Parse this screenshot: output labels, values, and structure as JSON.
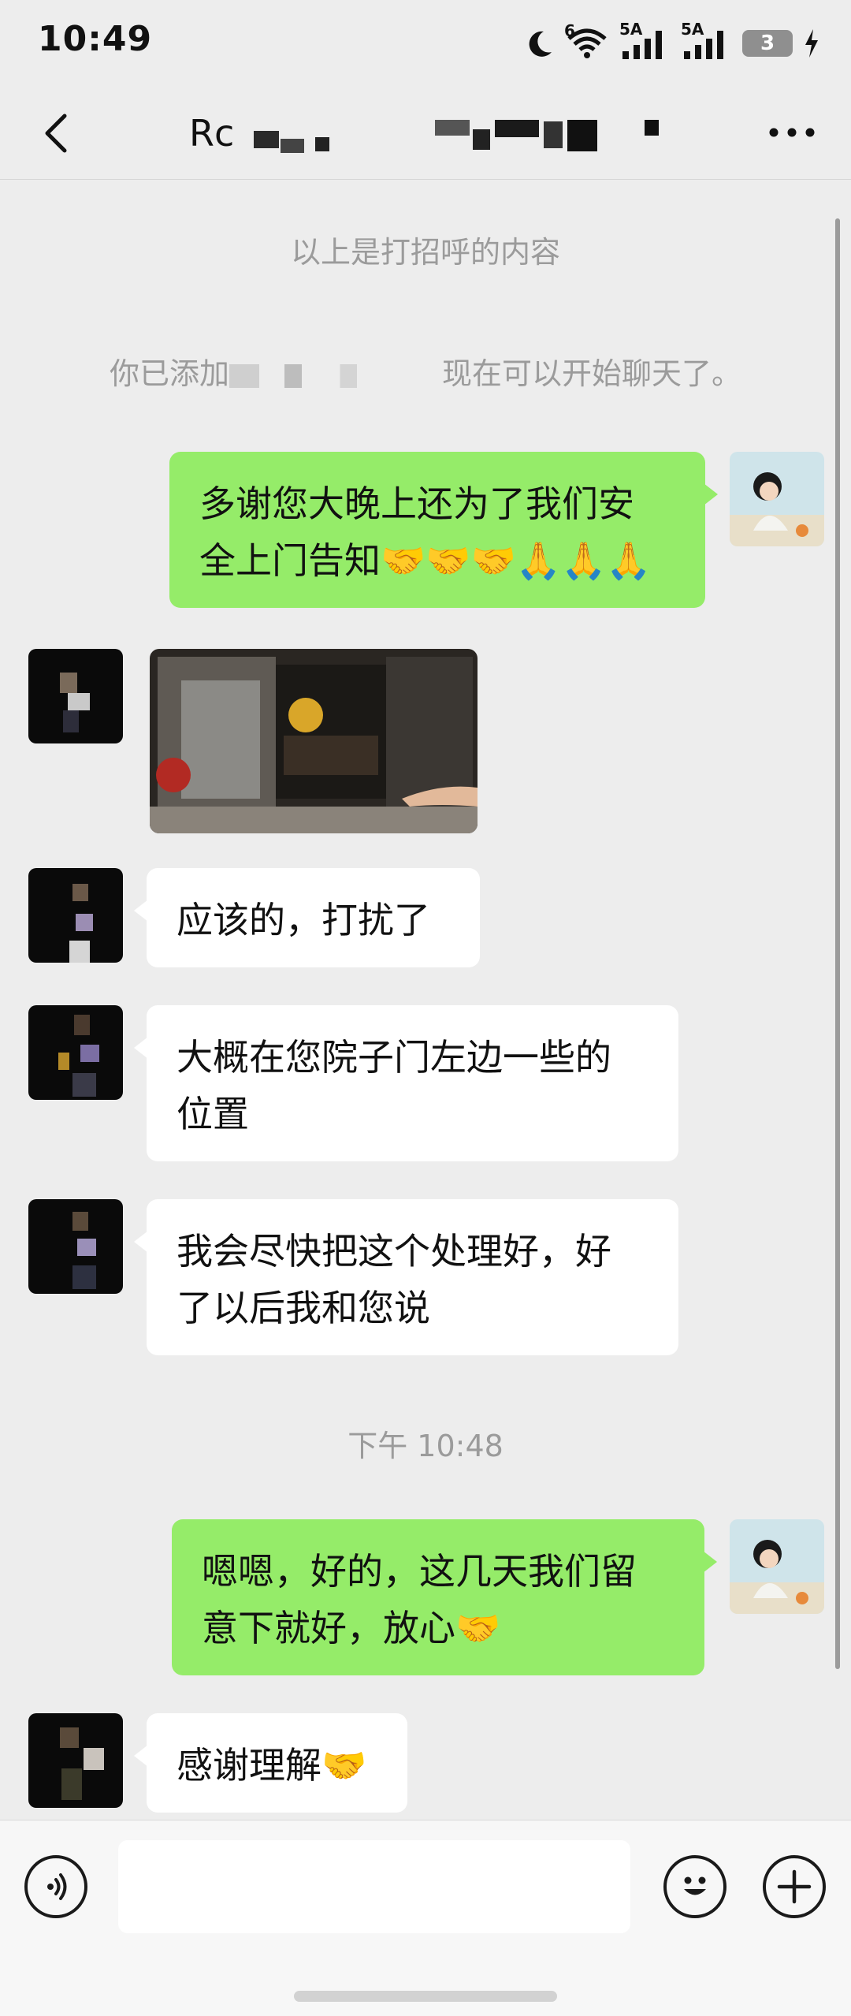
{
  "status_bar": {
    "time": "10:49",
    "signal1_label": "5A",
    "signal2_label": "5A",
    "wifi_label": "6",
    "battery": "3"
  },
  "header": {
    "title": "Rc"
  },
  "messages": {
    "sys_greeting": "以上是打招呼的内容",
    "sys_added_prefix": "你已添加",
    "sys_added_suffix": "现在可以开始聊天了。",
    "msg1_line1": "多谢您大晚上还为了我们安",
    "msg1_line2": "全上门告知🤝🤝🤝🙏🙏🙏",
    "msg3": "应该的，打扰了",
    "msg4_line1": "大概在您院子门左边一些的",
    "msg4_line2": "位置",
    "msg5_line1": "我会尽快把这个处理好，好",
    "msg5_line2": "了以后我和您说",
    "timestamp": "下午 10:48",
    "msg6_line1": "嗯嗯，好的，这几天我们留",
    "msg6_line2": "意下就好，放心🤝",
    "msg7": "感谢理解🤝"
  },
  "colors": {
    "mine_bubble": "#95ec69",
    "theirs_bubble": "#ffffff",
    "background": "#ededed"
  },
  "icons": [
    "moon-icon",
    "wifi-icon",
    "signal-icon",
    "battery-icon",
    "back-icon",
    "more-icon",
    "voice-icon",
    "emoji-icon",
    "plus-icon"
  ]
}
